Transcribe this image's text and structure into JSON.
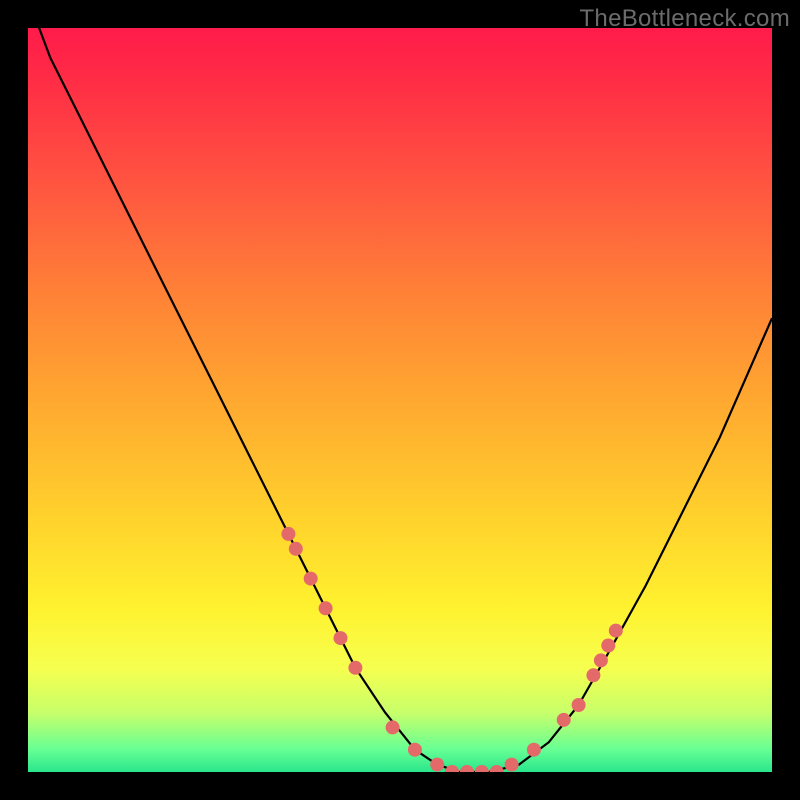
{
  "watermark": "TheBottleneck.com",
  "colors": {
    "page_bg": "#000000",
    "gradient_top": "#ff1b4a",
    "gradient_bottom": "#29e68b",
    "curve": "#000000",
    "dots": "#e46a6a"
  },
  "chart_data": {
    "type": "line",
    "title": "",
    "xlabel": "",
    "ylabel": "",
    "xlim": [
      0,
      100
    ],
    "ylim": [
      0,
      100
    ],
    "grid": false,
    "legend": false,
    "series": [
      {
        "name": "bottleneck-curve",
        "x": [
          0,
          3,
          7,
          12,
          18,
          24,
          30,
          35,
          40,
          44,
          48,
          52,
          55,
          58,
          62,
          66,
          70,
          74,
          78,
          83,
          88,
          93,
          100
        ],
        "y": [
          104,
          96,
          88,
          78,
          66,
          54,
          42,
          32,
          22,
          14,
          8,
          3,
          1,
          0,
          0,
          1,
          4,
          9,
          16,
          25,
          35,
          45,
          61
        ]
      }
    ],
    "dots": {
      "name": "highlight-dots",
      "x": [
        35,
        36,
        38,
        40,
        42,
        44,
        49,
        52,
        55,
        57,
        59,
        61,
        63,
        65,
        68,
        72,
        74,
        76,
        77,
        78,
        79
      ],
      "y": [
        32,
        30,
        26,
        22,
        18,
        14,
        6,
        3,
        1,
        0,
        0,
        0,
        0,
        1,
        3,
        7,
        9,
        13,
        15,
        17,
        19
      ]
    }
  }
}
